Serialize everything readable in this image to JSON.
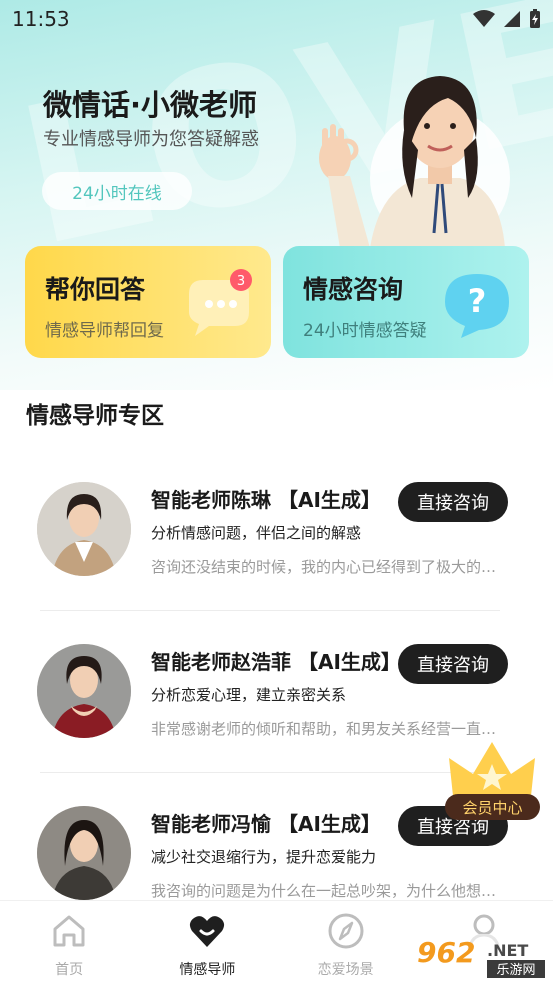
{
  "status": {
    "time": "11:53"
  },
  "hero": {
    "watermark_text": "LOVE",
    "title": "微情话·小微老师",
    "subtitle": "专业情感导师为您答疑解惑",
    "online_label": "24小时在线"
  },
  "cards": {
    "answer": {
      "title": "帮你回答",
      "subtitle": "情感导师帮回复",
      "badge": "3"
    },
    "consult": {
      "title": "情感咨询",
      "subtitle": "24小时情感答疑"
    }
  },
  "section": {
    "title": "情感导师专区"
  },
  "tutors": [
    {
      "name": "智能老师陈琳 【AI生成】",
      "desc": "分析情感问题，伴侣之间的解惑",
      "last": "咨询还没结束的时候，我的内心已经得到了极大的…",
      "button": "直接咨询"
    },
    {
      "name": "智能老师赵浩菲 【AI生成】",
      "desc": "分析恋爱心理，建立亲密关系",
      "last": "非常感谢老师的倾听和帮助，和男友关系经营一直…",
      "button": "直接咨询"
    },
    {
      "name": "智能老师冯愉 【AI生成】",
      "desc": "减少社交退缩行为，提升恋爱能力",
      "last": "我咨询的问题是为什么在一起总吵架，为什么他想…",
      "button": "直接咨询"
    }
  ],
  "vip": {
    "label": "会员中心"
  },
  "nav": {
    "items": [
      {
        "label": "首页",
        "icon": "home-icon"
      },
      {
        "label": "情感导师",
        "icon": "heart-icon"
      },
      {
        "label": "恋爱场景",
        "icon": "compass-icon"
      },
      {
        "label": "",
        "icon": "profile-icon"
      }
    ]
  },
  "watermark": {
    "text": "962",
    "suffix": ".NET",
    "site": "乐游网"
  },
  "colors": {
    "accent": "#52c6bd",
    "yellow": "#ffd84a",
    "teal": "#7fe3de",
    "dark": "#1f1f1f"
  }
}
